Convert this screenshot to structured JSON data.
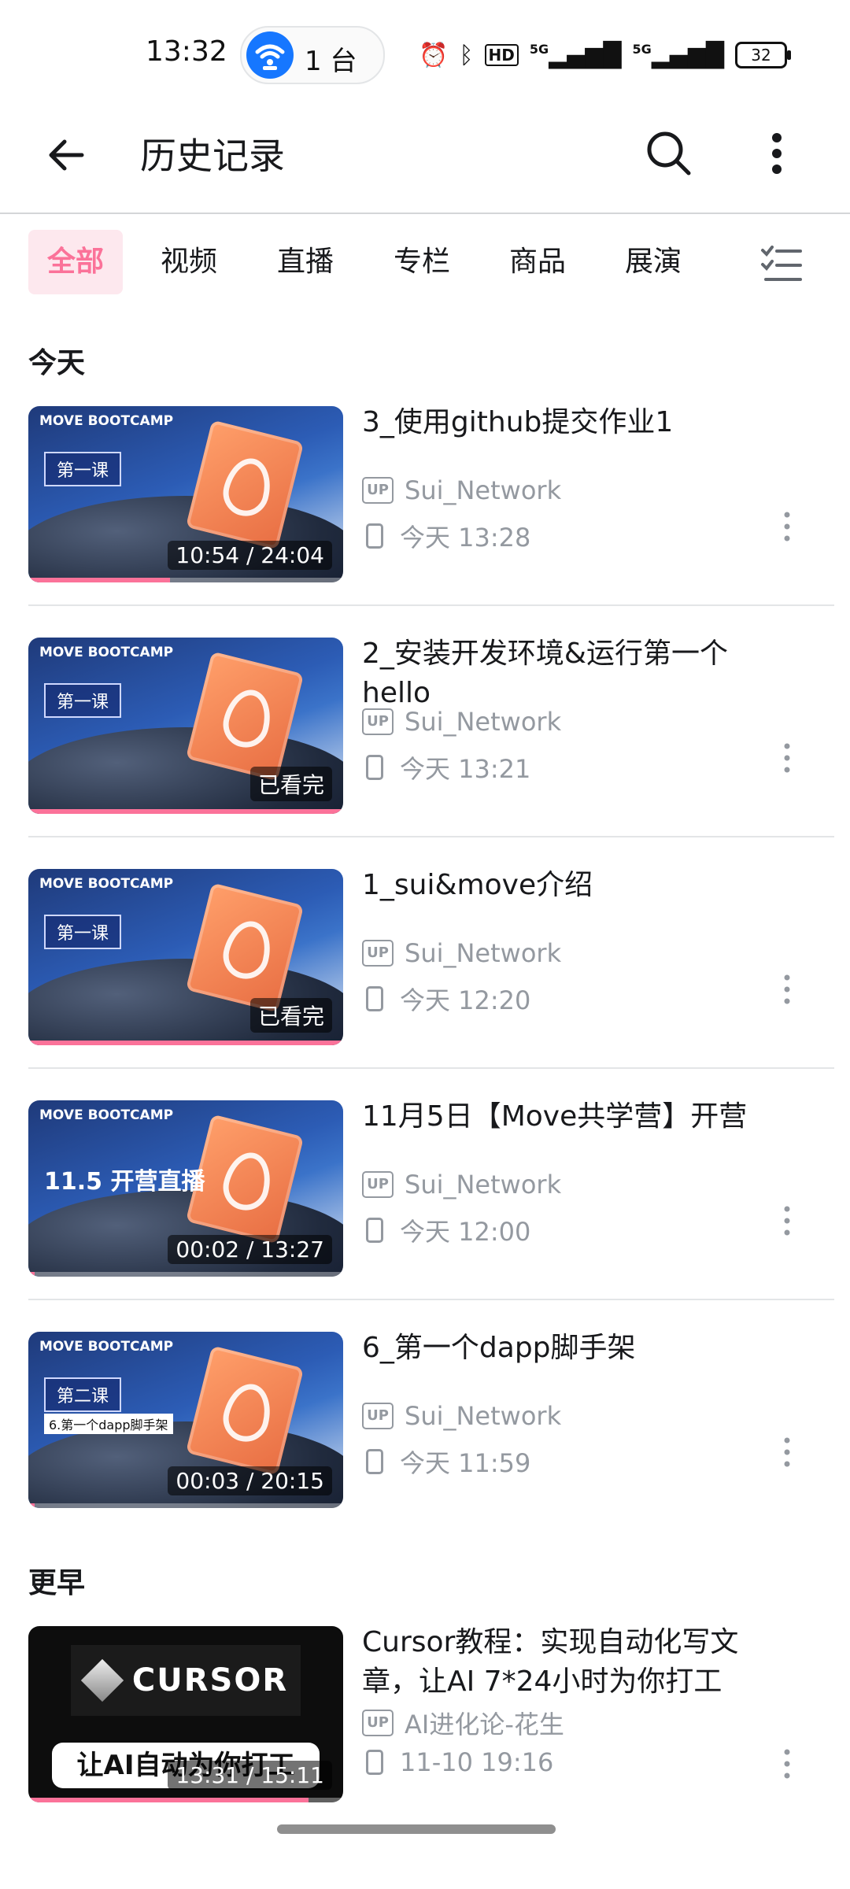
{
  "status_bar": {
    "time": "13:32",
    "hotspot_count": "1 台",
    "signal_1": "5G",
    "signal_2": "5G",
    "hd": "HD",
    "battery": "32"
  },
  "header": {
    "title": "历史记录"
  },
  "tabs": [
    {
      "label": "全部",
      "active": true
    },
    {
      "label": "视频"
    },
    {
      "label": "直播"
    },
    {
      "label": "专栏"
    },
    {
      "label": "商品"
    },
    {
      "label": "展演"
    }
  ],
  "sections": {
    "today": "今天",
    "earlier": "更早"
  },
  "items": [
    {
      "title": "3_使用github提交作业1",
      "up": "Sui_Network",
      "watched": "今天 13:28",
      "overlay": "10:54 / 24:04",
      "progress": 0.45,
      "thumb_brand": "MOVE BOOTCAMP",
      "thumb_text": "第一课",
      "thumb_variant": "lesson"
    },
    {
      "title": "2_安装开发环境&运行第一个hello",
      "up": "Sui_Network",
      "watched": "今天 13:21",
      "overlay": "已看完",
      "progress": 1.0,
      "thumb_brand": "MOVE BOOTCAMP",
      "thumb_text": "第一课",
      "thumb_variant": "lesson"
    },
    {
      "title": "1_sui&move介绍",
      "up": "Sui_Network",
      "watched": "今天 12:20",
      "overlay": "已看完",
      "progress": 1.0,
      "thumb_brand": "MOVE BOOTCAMP",
      "thumb_text": "第一课",
      "thumb_variant": "lesson"
    },
    {
      "title": "11月5日【Move共学营】开营",
      "up": "Sui_Network",
      "watched": "今天 12:00",
      "overlay": "00:02 / 13:27",
      "progress": 0.01,
      "thumb_brand": "MOVE BOOTCAMP",
      "thumb_text": "11.5 开营直播",
      "thumb_variant": "big"
    },
    {
      "title": "6_第一个dapp脚手架",
      "up": "Sui_Network",
      "watched": "今天 11:59",
      "overlay": "00:03 / 20:15",
      "progress": 0.01,
      "thumb_brand": "MOVE BOOTCAMP",
      "thumb_text": "第二课",
      "thumb_sub": "6.第一个dapp脚手架",
      "thumb_variant": "lesson"
    },
    {
      "title": "Cursor教程：实现自动化写文章，让AI 7*24小时为你打工",
      "up": "AI进化论-花生",
      "watched": "11-10 19:16",
      "overlay": "13:31 / 15:11",
      "progress": 0.89,
      "thumb_logo": "CURSOR",
      "thumb_banner": "让AI自动为你打工",
      "thumb_variant": "cursor"
    }
  ],
  "labels": {
    "up_badge": "UP"
  },
  "colors": {
    "accent": "#fb7299",
    "muted": "#9499a0",
    "text": "#18191c"
  }
}
